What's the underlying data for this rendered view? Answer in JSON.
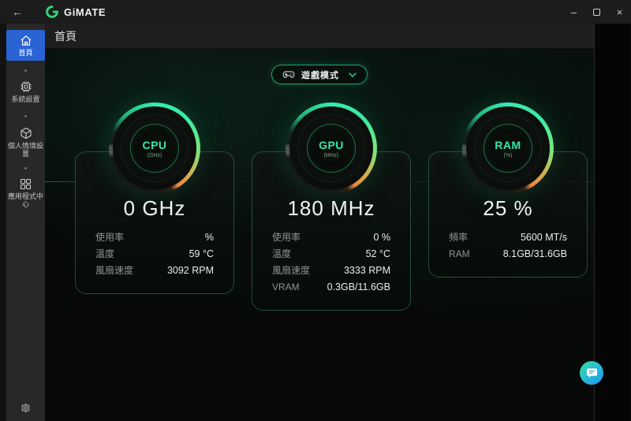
{
  "titlebar": {
    "back_icon": "←",
    "app_name": "GiMATE",
    "minimize_icon": "–",
    "close_icon": "×"
  },
  "sidebar": {
    "items": [
      {
        "label": "首頁",
        "active": true
      },
      {
        "label": "系統設置",
        "active": false
      },
      {
        "label": "個人情境設置",
        "active": false
      },
      {
        "label": "應用程式中心",
        "active": false
      }
    ]
  },
  "header": {
    "title": "首頁"
  },
  "mode_selector": {
    "label": "遊戲模式"
  },
  "cards": [
    {
      "gauge_label": "CPU",
      "gauge_unit": "(GHz)",
      "value": "0 GHz",
      "stats": [
        {
          "label": "使用率",
          "value": "%"
        },
        {
          "label": "溫度",
          "value": "59 °C"
        },
        {
          "label": "風扇速度",
          "value": "3092 RPM"
        }
      ]
    },
    {
      "gauge_label": "GPU",
      "gauge_unit": "(MHz)",
      "value": "180 MHz",
      "stats": [
        {
          "label": "使用率",
          "value": "0 %"
        },
        {
          "label": "溫度",
          "value": "52 °C"
        },
        {
          "label": "風扇速度",
          "value": "3333 RPM"
        },
        {
          "label": "VRAM",
          "value": "0.3GB/11.6GB"
        }
      ]
    },
    {
      "gauge_label": "RAM",
      "gauge_unit": "(%)",
      "value": "25 %",
      "stats": [
        {
          "label": "頻率",
          "value": "5600 MT/s"
        },
        {
          "label": "RAM",
          "value": "8.1GB/31.6GB"
        }
      ]
    }
  ],
  "colors": {
    "accent_teal": "#2ee6a8",
    "accent_orange": "#ee8440",
    "active_blue": "#2a63d4",
    "logo_green": "#2ed573",
    "chat_gradient_start": "#35e0a0",
    "chat_gradient_end": "#2196f3"
  }
}
